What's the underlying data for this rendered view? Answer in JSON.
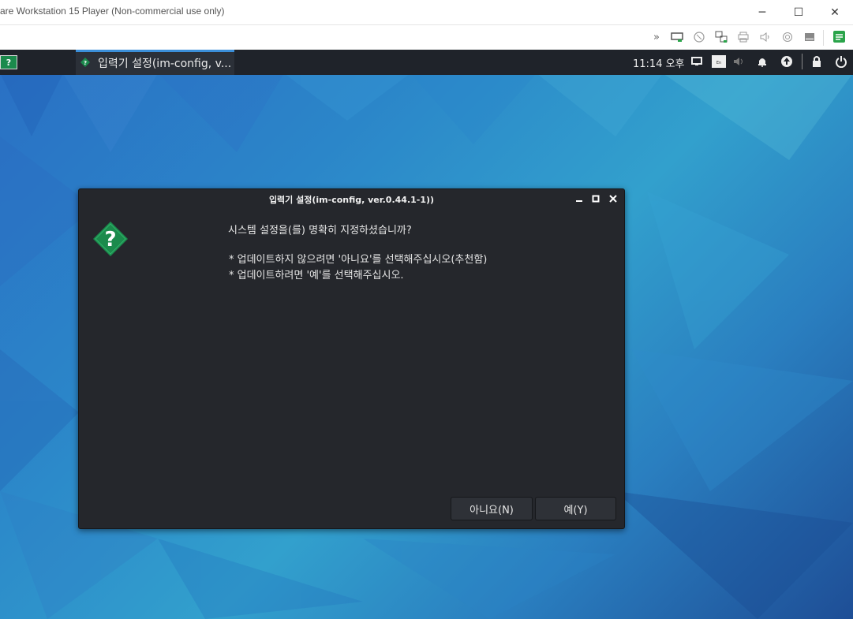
{
  "host": {
    "title": "are Workstation 15 Player (Non-commercial use only)",
    "controls": {
      "minimize": "─",
      "maximize": "☐",
      "close": "✕"
    },
    "toolbar_icons": [
      "double-chevron-icon",
      "removable-device-icon",
      "network-icon",
      "usb-icon",
      "printer-icon",
      "sound-icon",
      "camera-icon",
      "hdd-icon",
      "notes-icon"
    ]
  },
  "panel": {
    "app_icon": "?",
    "task_label": "입력기 설정(im-config, v...",
    "clock": "11:14 오후",
    "tray_icons": [
      "display-icon",
      "keyboard-icon",
      "volume-icon",
      "bell-icon",
      "update-icon",
      "lock-icon",
      "power-icon"
    ]
  },
  "dialog": {
    "title": "입력기 설정(im-config, ver.0.44.1-1))",
    "question": "시스템 설정을(를) 명확히 지정하셨습니까?",
    "line1": "* 업데이트하지 않으려면 '아니요'를 선택해주십시오(추천함)",
    "line2": "* 업데이트하려면 '예'를 선택해주십시오.",
    "no_button": "아니요(N)",
    "yes_button": "예(Y)",
    "icon_glyph": "?"
  },
  "colors": {
    "accent": "#3b8fd9",
    "question_icon": "#1b8a4c",
    "dialog_bg": "#25272c",
    "panel_bg": "#1f232a"
  }
}
